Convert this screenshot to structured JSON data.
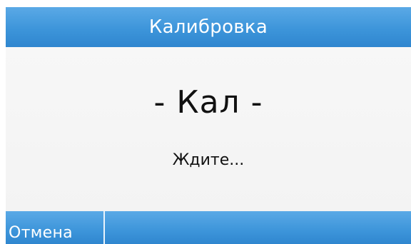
{
  "header": {
    "title": "Калибровка"
  },
  "status": {
    "main": "- Кал -",
    "message": "Ждите..."
  },
  "footer": {
    "cancel_label": "Отмена"
  },
  "colors": {
    "accent_blue": "#3d95da",
    "panel_background": "#f5f5f5",
    "text": "#111111"
  }
}
